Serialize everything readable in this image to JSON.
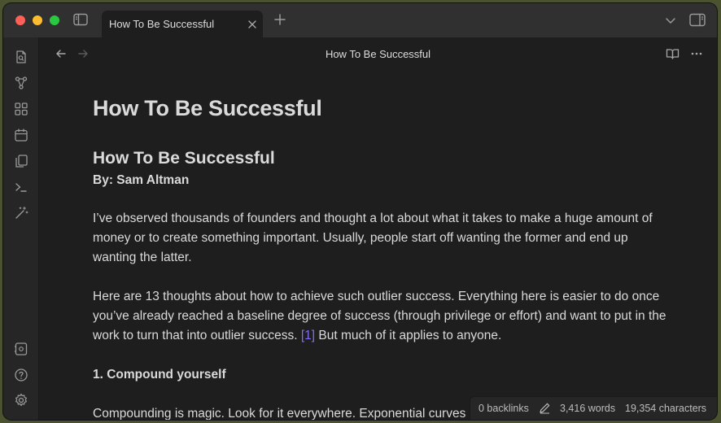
{
  "window": {
    "tab_title": "How To Be Successful",
    "view_title": "How To Be Successful"
  },
  "icons": {
    "ribbon": [
      "file-search-icon",
      "graph-icon",
      "canvas-icon",
      "calendar-icon",
      "copy-icon",
      "terminal-icon",
      "magic-wand-icon"
    ],
    "ribbon_bottom": [
      "vault-icon",
      "help-icon",
      "settings-icon"
    ]
  },
  "note": {
    "title": "How To Be Successful",
    "heading": "How To Be Successful",
    "byline": "By: Sam Altman",
    "paragraph1": "I’ve observed thousands of founders and thought a lot about what it takes to make a huge amount of money or to create something important. Usually, people start off wanting the former and end up wanting the latter.",
    "paragraph2_start": "Here are 13 thoughts about how to achieve such outlier success. Everything here is easier to do once you’ve already reached a baseline degree of success (through privilege or effort) and want to put in the work to turn that into outlier success. ",
    "footnote": "[1]",
    "paragraph2_end": " But much of it applies to anyone.",
    "section1": "1. Compound yourself",
    "paragraph3": "Compounding is magic. Look for it everywhere. Exponential curves"
  },
  "status": {
    "backlinks": "0 backlinks",
    "words": "3,416 words",
    "characters": "19,354 characters"
  }
}
